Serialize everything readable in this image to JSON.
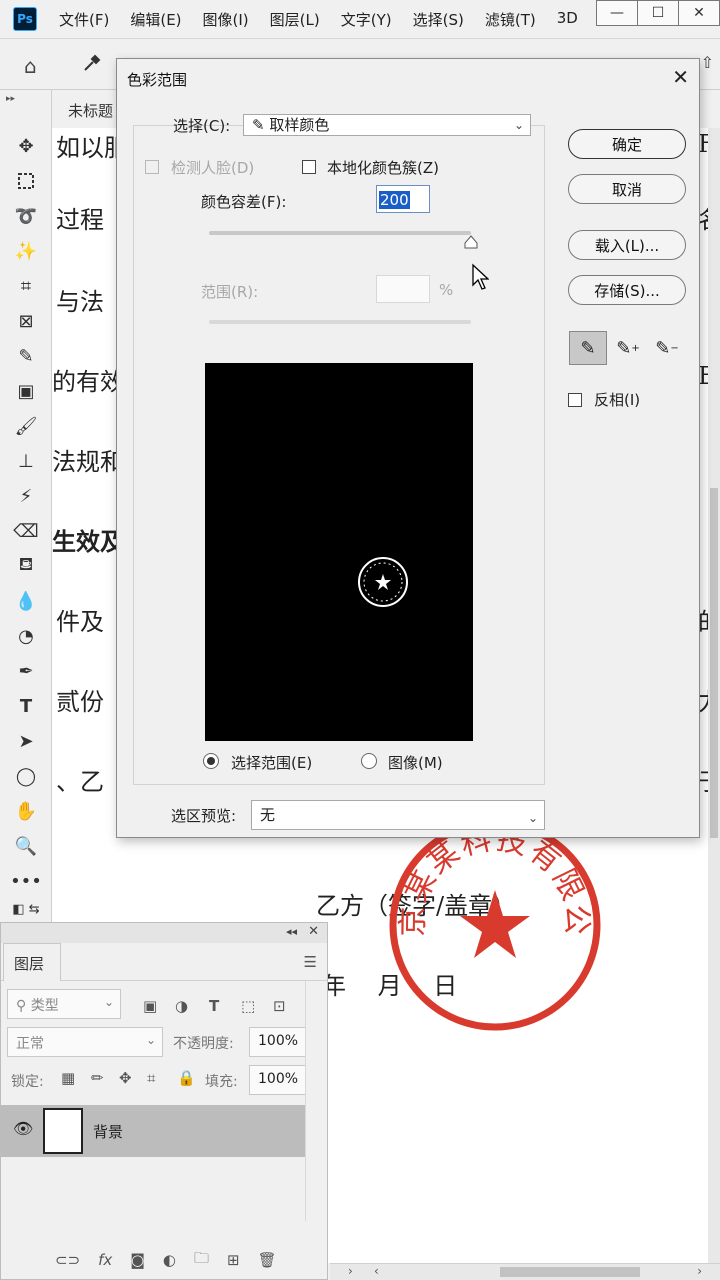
{
  "app": {
    "logo_text": "Ps",
    "menu": [
      "文件(F)",
      "编辑(E)",
      "图像(I)",
      "图层(L)",
      "文字(Y)",
      "选择(S)",
      "滤镜(T)",
      "3D"
    ],
    "window_controls": {
      "minimize": "—",
      "maximize": "☐",
      "close": "✕"
    }
  },
  "document": {
    "tab_title": "未标题",
    "lines": [
      "如以服",
      "过程",
      "与法",
      "的有效",
      "法规和",
      "生效及",
      "件及",
      "贰份",
      "、乙",
      "乙方（签字/盖章）",
      "年　 月　 日"
    ],
    "right_fragments": [
      "F",
      "名",
      "E",
      "的",
      "力",
      "于"
    ],
    "stamp": {
      "text": "北京某某科技有限公司",
      "color": "#d93a2e"
    }
  },
  "layers_panel": {
    "tab": "图层",
    "filter_kind": "类型",
    "blend_mode": "正常",
    "opacity_label": "不透明度:",
    "opacity_value": "100%",
    "lock_label": "锁定:",
    "fill_label": "填充:",
    "fill_value": "100%",
    "layer_name": "背景",
    "footer_icons": [
      "link-icon",
      "fx-icon",
      "mask-icon",
      "adjustment-icon",
      "folder-icon",
      "new-layer-icon",
      "trash-icon"
    ]
  },
  "dialog": {
    "title": "色彩范围",
    "select_label": "选择(C):",
    "select_value": "取样颜色",
    "detect_faces": "检测人脸(D)",
    "localized": "本地化颜色簇(Z)",
    "fuzziness_label": "颜色容差(F):",
    "fuzziness_value": "200",
    "range_label": "范围(R):",
    "range_unit": "%",
    "radio_selection": "选择范围(E)",
    "radio_image": "图像(M)",
    "preview_label": "选区预览:",
    "preview_value": "无",
    "buttons": {
      "ok": "确定",
      "cancel": "取消",
      "load": "载入(L)...",
      "save": "存储(S)..."
    },
    "invert_label": "反相(I)",
    "fuzziness_fraction": 1.0
  }
}
